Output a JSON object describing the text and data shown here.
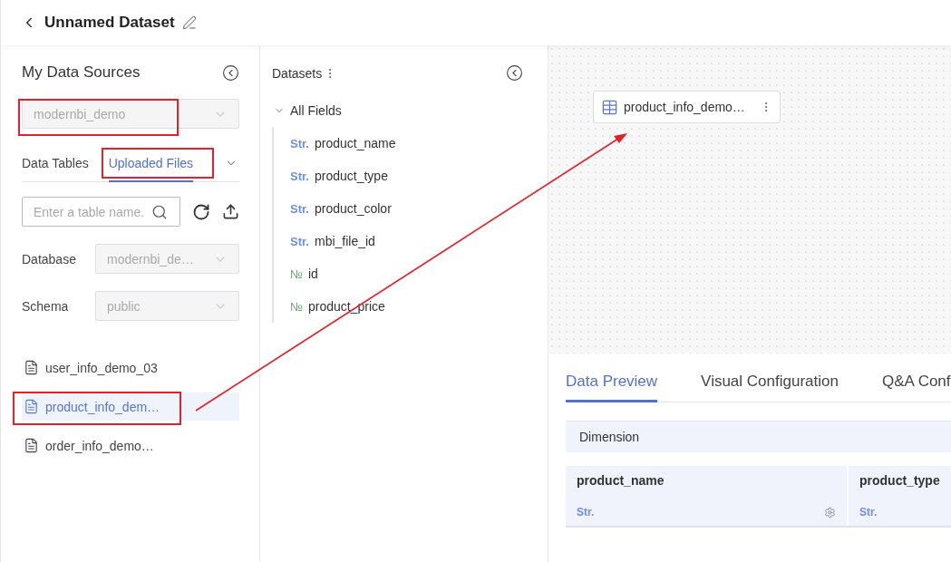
{
  "header": {
    "title": "Unnamed Dataset"
  },
  "data_sources": {
    "title": "My Data Sources",
    "source": {
      "value": "modernbi_demo",
      "disabled": true,
      "highlighted": true
    },
    "tabs": [
      {
        "label": "Data Tables",
        "selected": false,
        "highlighted": false
      },
      {
        "label": "Uploaded Files",
        "selected": true,
        "highlighted": true
      }
    ],
    "search": {
      "placeholder": "Enter a table name."
    },
    "filters": [
      {
        "label": "Database",
        "value": "modernbi_de…",
        "disabled": true
      },
      {
        "label": "Schema",
        "value": "public",
        "disabled": true
      }
    ],
    "files": [
      {
        "name": "user_info_demo_03",
        "selected": false,
        "highlighted": false
      },
      {
        "name": "product_info_dem…",
        "selected": true,
        "highlighted": true
      },
      {
        "name": "order_info_demo…",
        "selected": false,
        "highlighted": false
      }
    ]
  },
  "datasets": {
    "title": "Datasets",
    "group": {
      "label": "All Fields",
      "expanded": true,
      "children": [
        {
          "type_tag": "Str.",
          "kind": "string",
          "name": "product_name"
        },
        {
          "type_tag": "Str.",
          "kind": "string",
          "name": "product_type"
        },
        {
          "type_tag": "Str.",
          "kind": "string",
          "name": "product_color"
        },
        {
          "type_tag": "Str.",
          "kind": "string",
          "name": "mbi_file_id"
        },
        {
          "type_tag": "№",
          "kind": "number",
          "name": "id"
        },
        {
          "type_tag": "№",
          "kind": "number",
          "name": "product_price"
        }
      ]
    }
  },
  "canvas": {
    "nodes": [
      {
        "name": "product_info_demo…"
      }
    ]
  },
  "preview": {
    "tabs": [
      {
        "label": "Data Preview",
        "selected": true
      },
      {
        "label": "Visual Configuration",
        "selected": false
      },
      {
        "label": "Q&A Conf",
        "selected": false
      }
    ],
    "section": "Dimension",
    "columns": [
      {
        "name": "product_name",
        "type_tag": "Str.",
        "kind": "string",
        "settings": true
      },
      {
        "name": "product_type",
        "type_tag": "Str.",
        "kind": "string",
        "settings": false
      }
    ]
  }
}
